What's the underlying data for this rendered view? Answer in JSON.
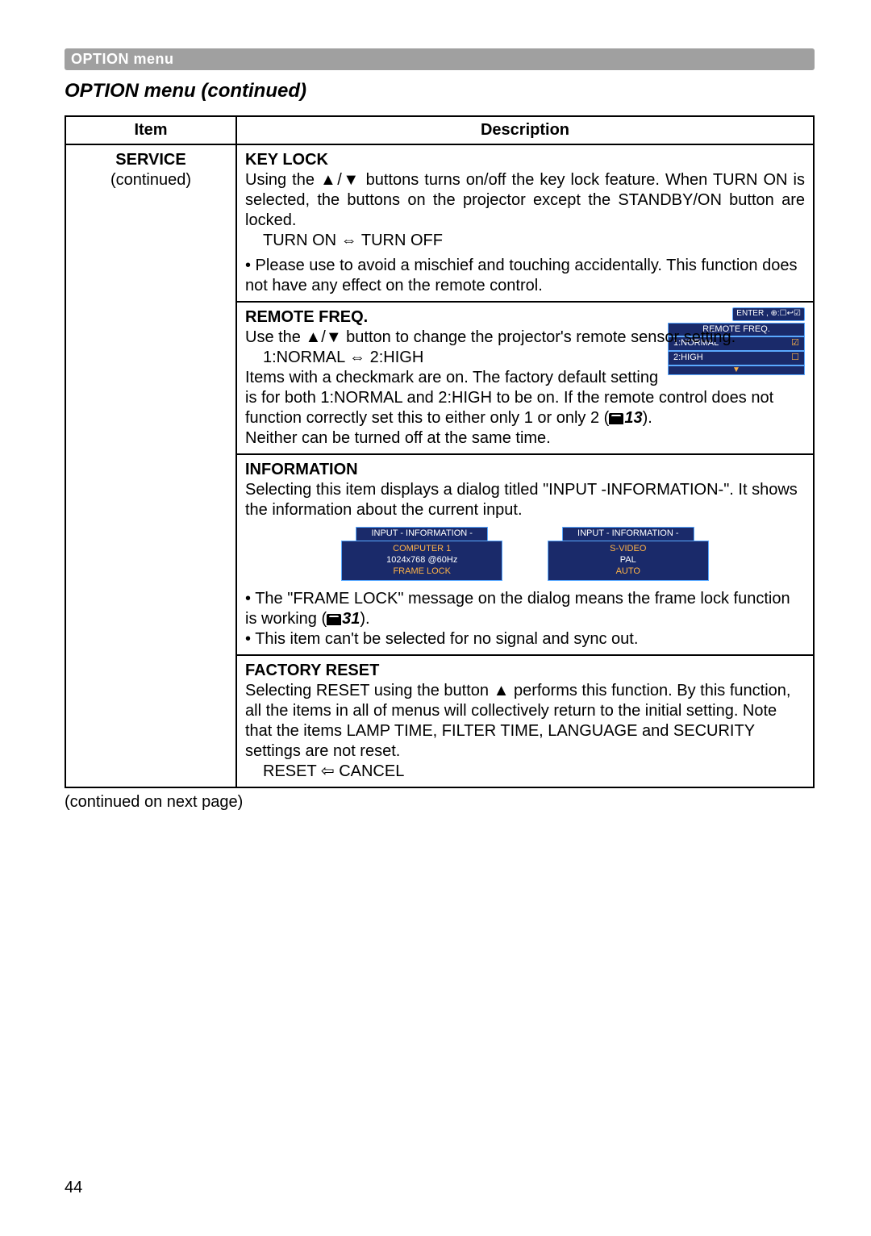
{
  "header": {
    "label": "OPTION menu"
  },
  "section_title": "OPTION menu (continued)",
  "table": {
    "headers": {
      "item": "Item",
      "description": "Description"
    },
    "item_cell": {
      "service": "SERVICE",
      "continued": "(continued)"
    },
    "keylock": {
      "title": "KEY LOCK",
      "p1": "Using the ▲/▼ buttons turns on/off the key lock feature. When TURN ON is selected, the buttons on the projector except the STANDBY/ON button are locked.",
      "toggle": "TURN ON ⇔ TURN OFF",
      "note": "• Please use to avoid a mischief and touching accidentally. This function does not have any effect on the remote control."
    },
    "remotefreq": {
      "title": "REMOTE FREQ.",
      "p1": "Use the ▲/▼ button to change the projector's remote sensor setting.",
      "toggle": "1:NORMAL ⇔ 2:HIGH",
      "p2a": "Items with a checkmark are on. The factory default setting is for both 1:NORMAL and 2:HIGH to be on.  If the remote control does not function correctly set this to either only 1 or only 2 (",
      "ref": "13",
      "p2b": ").",
      "p3": "Neither can be turned off at the same time.",
      "osd": {
        "caption": "ENTER , ⊕:☐↩☑",
        "title": "REMOTE FREQ.",
        "row1": {
          "label": "1:NORMAL",
          "check": "☑"
        },
        "row2": {
          "label": "2:HIGH",
          "check": "☐"
        },
        "arrow": "▼"
      }
    },
    "information": {
      "title": "INFORMATION",
      "p1": "Selecting this item displays a dialog titled \"INPUT -INFORMATION-\". It shows the information about the current input.",
      "note1a": "• The \"FRAME LOCK\" message on the dialog means the frame lock function is working (",
      "ref": "31",
      "note1b": ").",
      "note2": "• This item can't be selected for no signal and sync out.",
      "osd1": {
        "head": "INPUT - INFORMATION -",
        "l1": "COMPUTER 1",
        "l2": "1024x768 @60Hz",
        "l3": "FRAME LOCK"
      },
      "osd2": {
        "head": "INPUT - INFORMATION -",
        "l1": "S-VIDEO",
        "l2": "PAL",
        "l3": "AUTO"
      }
    },
    "factoryreset": {
      "title": "FACTORY RESET",
      "p1": "Selecting RESET using the button ▲ performs this function. By this function, all the items in all of menus will collectively return to the initial setting. Note that the items LAMP TIME, FILTER TIME, LANGUAGE and SECURITY settings are not reset.",
      "toggle": "RESET ⇦ CANCEL"
    }
  },
  "footer_note": "(continued on next page)",
  "page_number": "44"
}
